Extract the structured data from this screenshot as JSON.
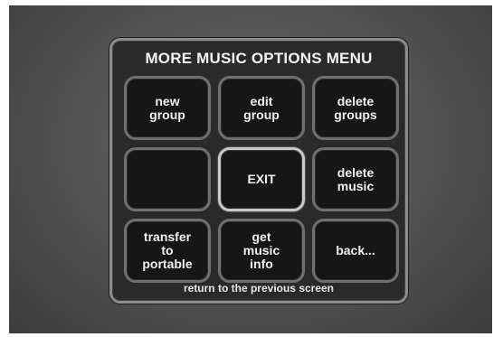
{
  "menu": {
    "title": "MORE MUSIC OPTIONS MENU",
    "buttons": [
      {
        "label": "new\ngroup"
      },
      {
        "label": "edit\ngroup"
      },
      {
        "label": "delete\ngroups"
      },
      {
        "label": ""
      },
      {
        "label": "EXIT"
      },
      {
        "label": "delete\nmusic"
      },
      {
        "label": "transfer\nto\nportable"
      },
      {
        "label": "get\nmusic\ninfo"
      },
      {
        "label": "back..."
      }
    ],
    "hint": "return to the previous screen"
  }
}
